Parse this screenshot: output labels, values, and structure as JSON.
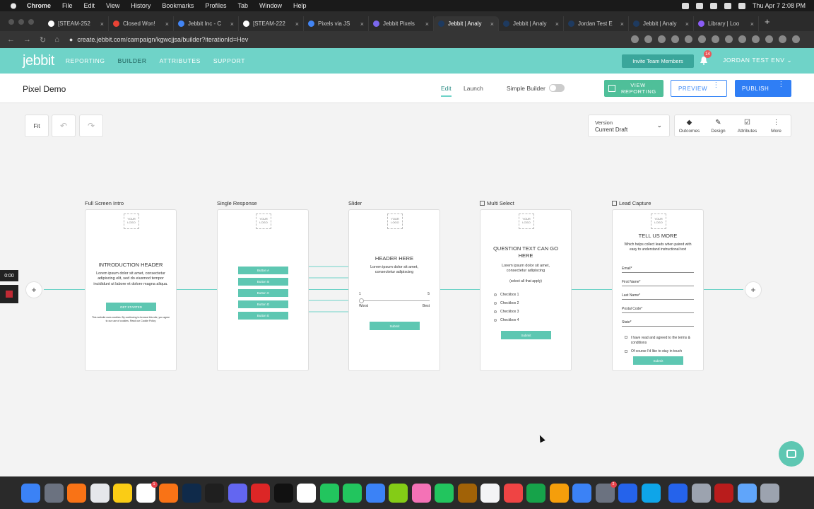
{
  "menubar": {
    "items": [
      "Chrome",
      "File",
      "Edit",
      "View",
      "History",
      "Bookmarks",
      "Profiles",
      "Tab",
      "Window",
      "Help"
    ],
    "clock": "Thu Apr 7  2:08 PM"
  },
  "browser": {
    "tabs": [
      {
        "label": "[STEAM-252",
        "color": "#ffffff"
      },
      {
        "label": "Closed Won!",
        "color": "#ea4335"
      },
      {
        "label": "Jebbit Inc - C",
        "color": "#4285f4"
      },
      {
        "label": "[STEAM-222",
        "color": "#ffffff"
      },
      {
        "label": "Pixels via JS",
        "color": "#4285f4"
      },
      {
        "label": "Jebbit Pixels",
        "color": "#7b68ee"
      },
      {
        "label": "Jebbit | Analy",
        "color": "#1e3a5f"
      },
      {
        "label": "Jebbit | Analy",
        "color": "#1e3a5f"
      },
      {
        "label": "Jordan Test E",
        "color": "#1e3a5f"
      },
      {
        "label": "Jebbit | Analy",
        "color": "#1e3a5f"
      },
      {
        "label": "Library | Loo",
        "color": "#8b5cf6"
      }
    ],
    "url": "create.jebbit.com/campaign/kgwcjjsa/builder?iterationId=Hev"
  },
  "jebbit_nav": {
    "logo": "jebbit",
    "links": [
      "REPORTING",
      "BUILDER",
      "ATTRIBUTES",
      "SUPPORT"
    ],
    "active_link": "BUILDER",
    "invite_label": "Invite Team Members",
    "notification_count": "14",
    "env_label": "JORDAN TEST ENV"
  },
  "subbar": {
    "title": "Pixel Demo",
    "tab_edit": "Edit",
    "tab_launch": "Launch",
    "simple_builder_label": "Simple Builder",
    "view_reporting": "VIEW REPORTING",
    "preview": "PREVIEW",
    "publish": "PUBLISH"
  },
  "controls": {
    "fit": "Fit",
    "version_label": "Version",
    "version_value": "Current Draft",
    "tools": [
      {
        "label": "Outcomes",
        "icon": "diamond-icon"
      },
      {
        "label": "Design",
        "icon": "brush-icon"
      },
      {
        "label": "Attributes",
        "icon": "checklist-icon"
      },
      {
        "label": "More",
        "icon": "more-icon"
      }
    ]
  },
  "recorder": {
    "time": "0:00"
  },
  "logo_placeholder": "YOUR LOGO",
  "cards": {
    "intro": {
      "title": "Full Screen Intro",
      "header": "INTRODUCTION HEADER",
      "body": "Lorem ipsum dolor sit amet, consectetur adipiscing elit, sed do eiusmod tempor incididunt ut labore et dolore magna aliqua.",
      "button": "GET STARTED",
      "fine_print": "This website uses cookies. By continuing to browse this site, you agree to our use of cookies. Read our Cookie Policy"
    },
    "single": {
      "title": "Single Response",
      "buttons": [
        "Button A",
        "Button B",
        "Button C",
        "Button D",
        "Button E"
      ]
    },
    "slider": {
      "title": "Slider",
      "header": "HEADER HERE",
      "body": "Lorem ipsum dolor sit amet, consectetur adipiscing",
      "min": "1",
      "max": "5",
      "min_label": "Worst",
      "max_label": "Best",
      "button": "Submit"
    },
    "multi": {
      "title": "Multi Select",
      "header": "QUESTION TEXT CAN GO HERE",
      "body": "Lorem ipsum dolor sit amet, consectetur adipiscing",
      "hint": "(select all that apply)",
      "options": [
        "Checkbox 1",
        "Checkbox 2",
        "Checkbox 3",
        "Checkbox 4"
      ],
      "button": "Submit"
    },
    "lead": {
      "title": "Lead Capture",
      "header": "TELL US MORE",
      "body": "Which helps collect leads when paired with easy to understand instructional text",
      "fields": [
        "Email*",
        "First Name*",
        "Last Name*",
        "Postal Code*",
        "State*"
      ],
      "consent_1": "I have read and agreed to the terms & conditions",
      "consent_2": "Of course I'd like to stay in touch",
      "button": "Submit"
    }
  },
  "dock": {
    "apps": [
      {
        "name": "finder-app",
        "color": "#3b82f6"
      },
      {
        "name": "launchpad-app",
        "color": "#6b7280"
      },
      {
        "name": "firefox-app",
        "color": "#f97316"
      },
      {
        "name": "chrome-app",
        "color": "#e5e7eb"
      },
      {
        "name": "notes-app",
        "color": "#facc15"
      },
      {
        "name": "slack-app",
        "color": "#ffffff",
        "badge": "1"
      },
      {
        "name": "sublime-app",
        "color": "#f97316"
      },
      {
        "name": "photoshop-app",
        "color": "#0f2a4a"
      },
      {
        "name": "figma-app",
        "color": "#1f1f1f"
      },
      {
        "name": "snagit-app",
        "color": "#6366f1"
      },
      {
        "name": "creative-cloud-app",
        "color": "#dc2626"
      },
      {
        "name": "terminal-app",
        "color": "#111111"
      },
      {
        "name": "calendar-app",
        "color": "#ffffff"
      },
      {
        "name": "spotify-app",
        "color": "#22c55e"
      },
      {
        "name": "messages-app",
        "color": "#22c55e"
      },
      {
        "name": "mail-app",
        "color": "#3b82f6"
      },
      {
        "name": "maps-app",
        "color": "#84cc16"
      },
      {
        "name": "photos-app",
        "color": "#f472b6"
      },
      {
        "name": "facetime-app",
        "color": "#22c55e"
      },
      {
        "name": "archive-app",
        "color": "#a16207"
      },
      {
        "name": "reminders-app",
        "color": "#f3f4f6"
      },
      {
        "name": "news-app",
        "color": "#ef4444"
      },
      {
        "name": "numbers-app",
        "color": "#16a34a"
      },
      {
        "name": "pages-app",
        "color": "#f59e0b"
      },
      {
        "name": "appstore-app",
        "color": "#3b82f6"
      },
      {
        "name": "settings-app",
        "color": "#6b7280",
        "badge": "2"
      },
      {
        "name": "dropbox-app",
        "color": "#2563eb"
      },
      {
        "name": "skype-app",
        "color": "#0ea5e9"
      },
      {
        "name": "zoom-app",
        "color": "#2563eb"
      },
      {
        "name": "screen-app",
        "color": "#9ca3af"
      },
      {
        "name": "dictionary-app",
        "color": "#b91c1c"
      },
      {
        "name": "downloads-app",
        "color": "#60a5fa"
      },
      {
        "name": "trash-app",
        "color": "#9ca3af"
      }
    ]
  }
}
